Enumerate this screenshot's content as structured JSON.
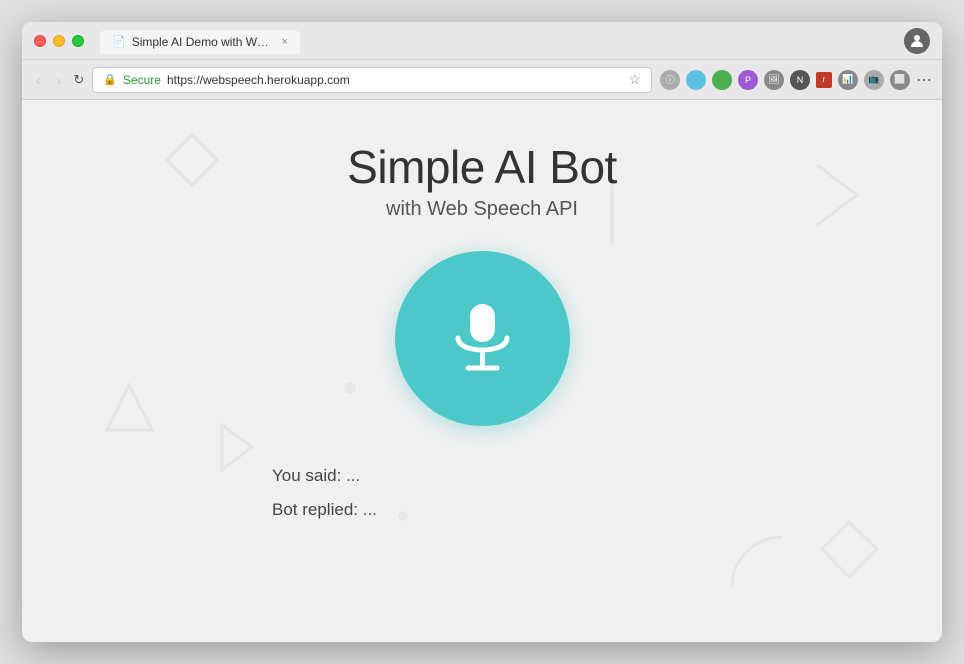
{
  "browser": {
    "tab_label": "Simple AI Demo with Web Spe",
    "tab_icon": "📄",
    "close_label": "×",
    "profile_icon": "👤",
    "nav_back": "‹",
    "nav_forward": "›",
    "reload": "↻",
    "secure_label": "Secure",
    "url": "https://webspeech.herokuapp.com",
    "bookmark_icon": "☆",
    "more_icon": "⋯"
  },
  "page": {
    "title": "Simple AI Bot",
    "subtitle": "with Web Speech API",
    "mic_label": "microphone",
    "you_said_label": "You said:",
    "you_said_value": "...",
    "bot_replied_label": "Bot replied:",
    "bot_replied_value": "..."
  },
  "colors": {
    "mic_bg": "#4DC8C8",
    "page_bg": "#f0f0f0"
  }
}
